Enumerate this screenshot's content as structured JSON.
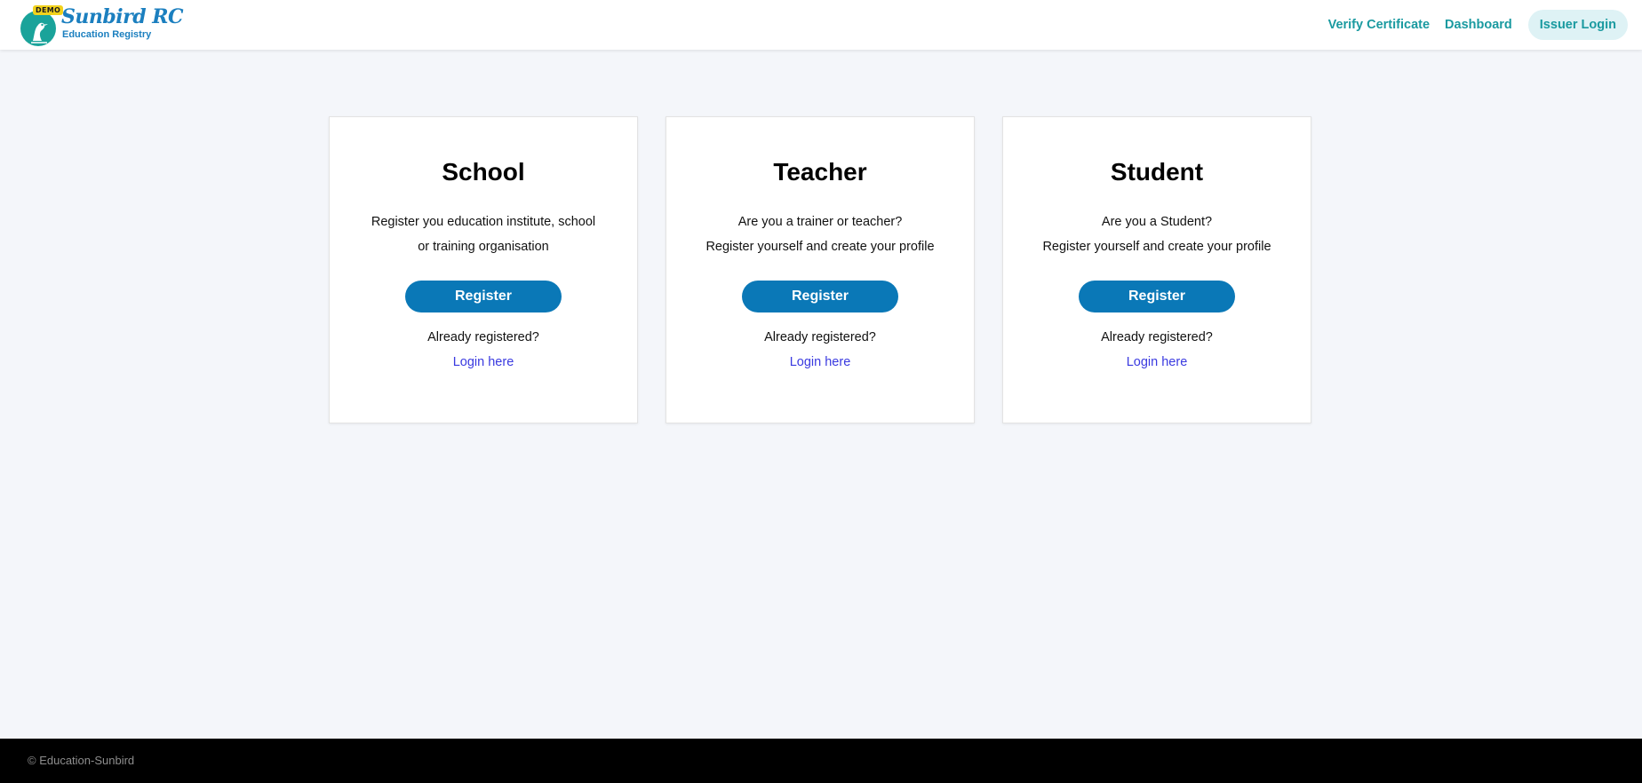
{
  "header": {
    "logo": {
      "badge": "DEMO",
      "title": "Sunbird RC",
      "subtitle": "Education Registry",
      "icon": "bird-icon"
    },
    "nav": {
      "verify_certificate": "Verify Certificate",
      "dashboard": "Dashboard",
      "issuer_login": "Issuer Login"
    }
  },
  "cards": [
    {
      "title": "School",
      "desc_line1": "Register you education institute, school",
      "desc_line2": "or training organisation",
      "register_label": "Register",
      "already_label": "Already registered?",
      "login_label": "Login here"
    },
    {
      "title": "Teacher",
      "desc_line1": "Are you a trainer or teacher?",
      "desc_line2": "Register yourself and create your profile",
      "register_label": "Register",
      "already_label": "Already registered?",
      "login_label": "Login here"
    },
    {
      "title": "Student",
      "desc_line1": "Are you a Student?",
      "desc_line2": "Register yourself and create your profile",
      "register_label": "Register",
      "already_label": "Already registered?",
      "login_label": "Login here"
    }
  ],
  "footer": {
    "copyright": "© Education-Sunbird"
  },
  "colors": {
    "primary_button": "#0a78b7",
    "nav_accent": "#1a9aa0",
    "link": "#3a3ae0",
    "page_background": "#f4f6fa",
    "footer_background": "#000000"
  }
}
